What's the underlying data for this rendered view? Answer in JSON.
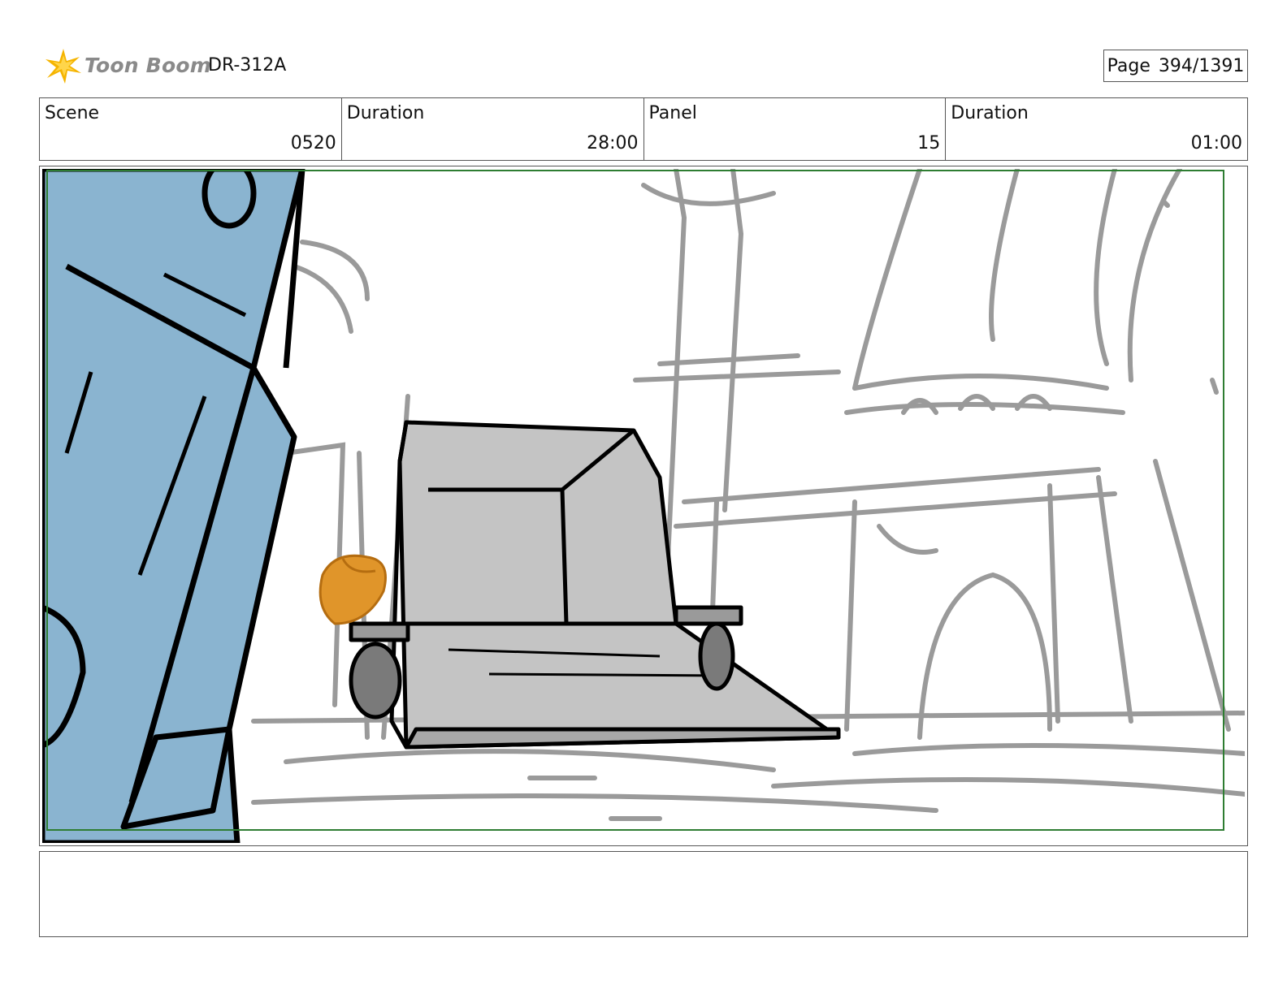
{
  "header": {
    "logo_text": "Toon Boom",
    "production_code": "DR-312A",
    "page_label": "Page",
    "page_number": "394/1391"
  },
  "info": [
    {
      "label": "Scene",
      "value": "0520"
    },
    {
      "label": "Duration",
      "value": "28:00"
    },
    {
      "label": "Panel",
      "value": "15"
    },
    {
      "label": "Duration",
      "value": "01:00"
    }
  ],
  "panel": {
    "safe_frame_color": "#2e7d32",
    "dumpster_color": "#8ab4d0",
    "cart_color": "#c4c4c4",
    "character_color": "#e0952a",
    "background_line_color": "#9a9a9a"
  },
  "caption": ""
}
